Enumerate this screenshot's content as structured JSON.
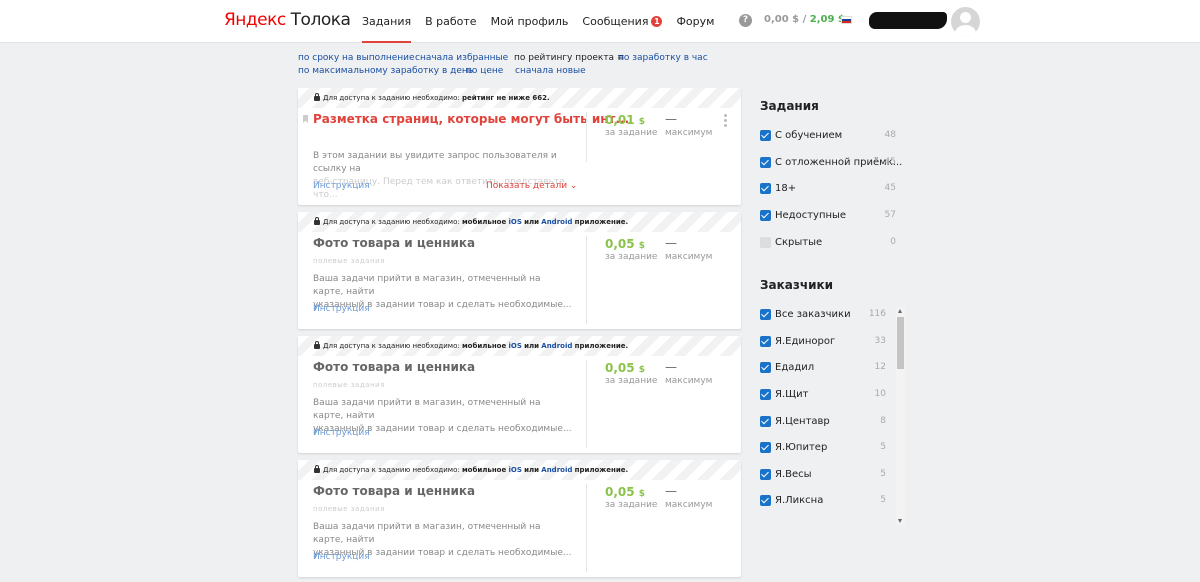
{
  "header": {
    "logo_primary": "Яндекс",
    "logo_secondary": "Толока",
    "nav": [
      {
        "label": "Задания",
        "active": true
      },
      {
        "label": "В работе"
      },
      {
        "label": "Мой профиль"
      },
      {
        "label": "Сообщения",
        "badge": "1"
      },
      {
        "label": "Форум"
      }
    ],
    "help_icon": "?",
    "balance_main": "0,00 $",
    "balance_sep": "/",
    "balance_pending": "2,09 $",
    "language_flag": "russia-flag-icon",
    "colors": {
      "accent": "#e0433c",
      "money": "#4caf50",
      "link": "#1a4ea3"
    }
  },
  "sorting": {
    "by_deadline": "по сроку на выполнение",
    "favorites_first": "сначала избранные",
    "by_project_rating": "по рейтингу проекта",
    "by_hourly": "по заработку в час",
    "by_max_daily": "по максимальному заработку в день",
    "by_price": "по цене",
    "newest_first": "сначала новые"
  },
  "cards": [
    {
      "access_prefix": "Для доступа к заданию необходимо:",
      "access_requirement": "рейтинг не ниже 662.",
      "title": "Разметка страниц, которые могут быть инт...",
      "subtitle": "",
      "desc_line1": "В этом задании вы увидите запрос пользователя и ссылку на",
      "desc_line2": "веб-страницу. Перед тем как ответить, представьте, что...",
      "instruction": "Инструкция",
      "show_details": "Показать детали ⌄",
      "price": "0,01",
      "currency": "$",
      "price_label": "за задание",
      "max_value": "—",
      "max_label": "максимум"
    },
    {
      "access_prefix": "Для доступа к заданию необходимо:",
      "access_mobile": "мобильное",
      "access_ios": "iOS",
      "access_or": "или",
      "access_android": "Android",
      "access_app": "приложение.",
      "title": "Фото товара и ценника",
      "subtitle": "полевые задания",
      "desc_line1": "Ваша задачи прийти в магазин, отмеченный на карте, найти",
      "desc_line2": "указанный в задании товар и сделать необходимые...",
      "instruction": "Инструкция",
      "price": "0,05",
      "currency": "$",
      "price_label": "за задание",
      "max_value": "—",
      "max_label": "максимум"
    },
    {
      "access_prefix": "Для доступа к заданию необходимо:",
      "access_mobile": "мобильное",
      "access_ios": "iOS",
      "access_or": "или",
      "access_android": "Android",
      "access_app": "приложение.",
      "title": "Фото товара и ценника",
      "subtitle": "полевые задания",
      "desc_line1": "Ваша задачи прийти в магазин, отмеченный на карте, найти",
      "desc_line2": "указанный в задании товар и сделать необходимые...",
      "instruction": "Инструкция",
      "price": "0,05",
      "currency": "$",
      "price_label": "за задание",
      "max_value": "—",
      "max_label": "максимум"
    },
    {
      "access_prefix": "Для доступа к заданию необходимо:",
      "access_mobile": "мобильное",
      "access_ios": "iOS",
      "access_or": "или",
      "access_android": "Android",
      "access_app": "приложение.",
      "title": "Фото товара и ценника",
      "subtitle": "полевые задания",
      "desc_line1": "Ваша задачи прийти в магазин, отмеченный на карте, найти",
      "desc_line2": "указанный в задании товар и сделать необходимые...",
      "instruction": "Инструкция",
      "price": "0,05",
      "currency": "$",
      "price_label": "за задание",
      "max_value": "—",
      "max_label": "максимум"
    }
  ],
  "sidebar": {
    "tasks_title": "Задания",
    "tasks_filters": [
      {
        "label": "С обучением",
        "count": "48",
        "checked": true
      },
      {
        "label": "С отложенной приёмк...",
        "count": "45",
        "checked": true
      },
      {
        "label": "18+",
        "count": "45",
        "checked": true
      },
      {
        "label": "Недоступные",
        "count": "57",
        "checked": true
      },
      {
        "label": "Скрытые",
        "count": "0",
        "checked": false
      }
    ],
    "customers_title": "Заказчики",
    "customers": [
      {
        "label": "Все заказчики",
        "count": "116",
        "checked": true
      },
      {
        "label": "Я.Единорог",
        "count": "33",
        "checked": true
      },
      {
        "label": "Едадил",
        "count": "12",
        "checked": true
      },
      {
        "label": "Я.Щит",
        "count": "10",
        "checked": true
      },
      {
        "label": "Я.Центавр",
        "count": "8",
        "checked": true
      },
      {
        "label": "Я.Юпитер",
        "count": "5",
        "checked": true
      },
      {
        "label": "Я.Весы",
        "count": "5",
        "checked": true
      },
      {
        "label": "Я.Ликсна",
        "count": "5",
        "checked": true
      }
    ]
  }
}
